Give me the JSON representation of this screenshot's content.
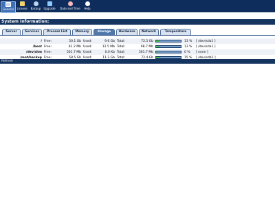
{
  "toolbar": {
    "items": [
      {
        "label": "General",
        "icon": "monitor-icon",
        "color": "#c9d7ea"
      },
      {
        "label": "License",
        "icon": "license-icon",
        "color": "#f2d36b"
      },
      {
        "label": "Backup",
        "icon": "backup-icon",
        "color": "#bcd3f0"
      },
      {
        "label": "Upgrade",
        "icon": "upgrade-icon",
        "color": "#8fc8ff"
      },
      {
        "label": "Date and Time",
        "icon": "clock-icon",
        "color": "#f6b9b9"
      },
      {
        "label": "Help",
        "icon": "help-icon",
        "color": "#ffffff"
      }
    ]
  },
  "page": {
    "title": "System Information:"
  },
  "tabs": [
    {
      "label": "Server"
    },
    {
      "label": "Services"
    },
    {
      "label": "Process List"
    },
    {
      "label": "Memory"
    },
    {
      "label": "Storage",
      "active": true
    },
    {
      "label": "Hardware"
    },
    {
      "label": "Network"
    },
    {
      "label": "Temperature"
    }
  ],
  "storage": {
    "rows": [
      {
        "mount": "/",
        "free_label": "Free:",
        "free": "50.1 Gb",
        "used_label": "Used:",
        "used": "9.6 Gb",
        "total_label": "Total:",
        "total": "72.5 Gb",
        "percent": 13,
        "percent_text": "13 %",
        "device": "[ /dev/sda1 ]"
      },
      {
        "mount": "/boot",
        "free_label": "Free:",
        "free": "81.2 Mb",
        "used_label": "Used:",
        "used": "12.5 Mb",
        "total_label": "Total:",
        "total": "98.7 Mb",
        "percent": 13,
        "percent_text": "13 %",
        "device": "[ /dev/sda1 ]"
      },
      {
        "mount": "/dev/shm",
        "free_label": "Free:",
        "free": "501.7 Mb",
        "used_label": "Used:",
        "used": "0.0 Kb",
        "total_label": "Total:",
        "total": "501.7 Mb",
        "percent": 0,
        "percent_text": "0 %",
        "device": "[ none ]"
      },
      {
        "mount": "/mnt/backup",
        "free_label": "Free:",
        "free": "58.5 Gb",
        "used_label": "Used:",
        "used": "11.2 Gb",
        "total_label": "Total:",
        "total": "72.4 Gb",
        "percent": 15,
        "percent_text": "15 %",
        "device": "[ /dev/sdb1 ]"
      }
    ]
  },
  "footer": {
    "refresh_label": "Refresh"
  }
}
